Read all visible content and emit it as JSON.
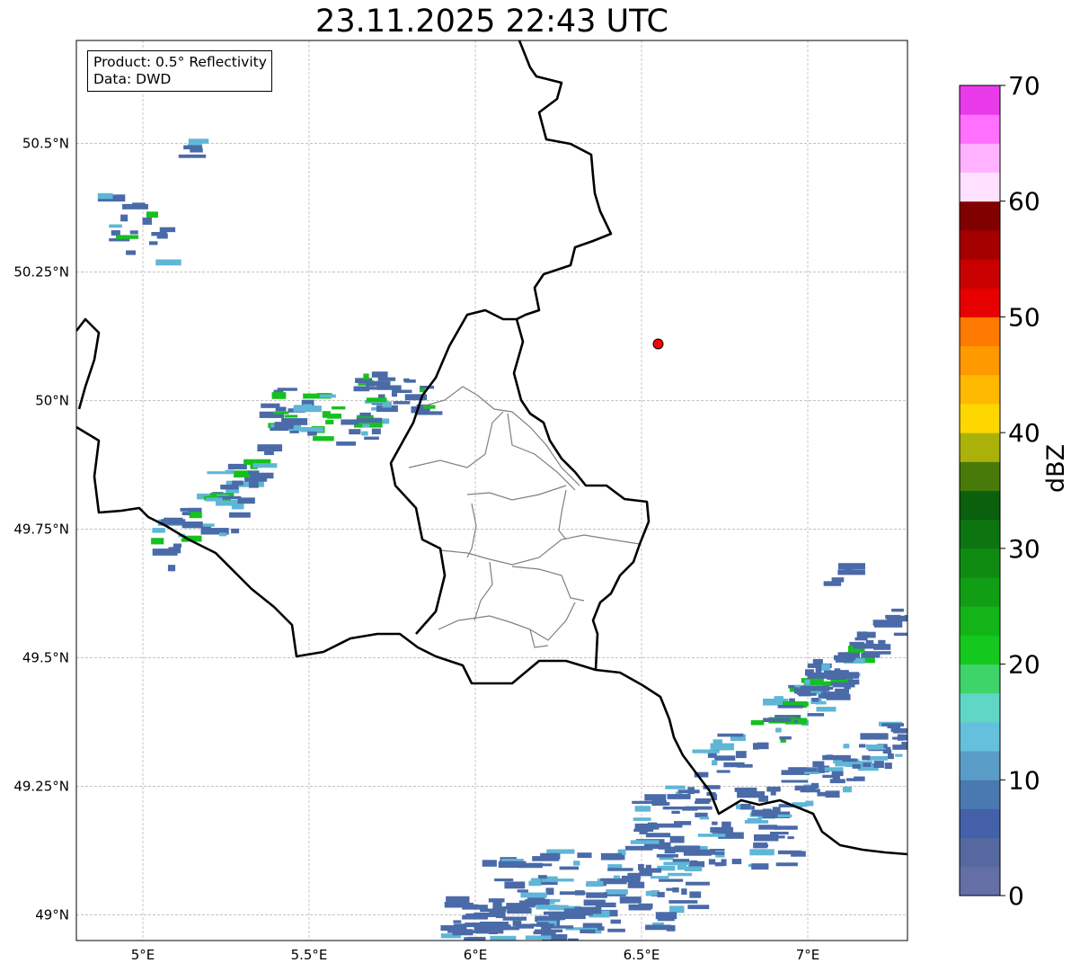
{
  "title": "23.11.2025 22:43 UTC",
  "legend": {
    "product": "Product: 0.5° Reflectivity",
    "data": "Data: DWD"
  },
  "axes": {
    "lon_range": [
      4.8,
      7.3
    ],
    "lat_range": [
      48.95,
      50.7
    ],
    "x_ticks": [
      {
        "value": 5.0,
        "label": "5°E"
      },
      {
        "value": 5.5,
        "label": "5.5°E"
      },
      {
        "value": 6.0,
        "label": "6°E"
      },
      {
        "value": 6.5,
        "label": "6.5°E"
      },
      {
        "value": 7.0,
        "label": "7°E"
      }
    ],
    "y_ticks": [
      {
        "value": 49.0,
        "label": "49°N"
      },
      {
        "value": 49.25,
        "label": "49.25°N"
      },
      {
        "value": 49.5,
        "label": "49.5°N"
      },
      {
        "value": 49.75,
        "label": "49.75°N"
      },
      {
        "value": 50.0,
        "label": "50°N"
      },
      {
        "value": 50.25,
        "label": "50.25°N"
      },
      {
        "value": 50.5,
        "label": "50.5°N"
      }
    ],
    "grid": true
  },
  "radar_site": {
    "lon": 6.55,
    "lat": 50.11,
    "color": "#ff0000"
  },
  "colorbar": {
    "label": "dBZ",
    "vmin": 0,
    "vmax": 70,
    "ticks": [
      "0",
      "10",
      "20",
      "30",
      "40",
      "50",
      "60",
      "70"
    ],
    "tick_values": [
      0,
      10,
      20,
      30,
      40,
      50,
      60,
      70
    ],
    "colors": [
      "#646fa6",
      "#5569a0",
      "#4460a8",
      "#4a78b0",
      "#5a9cc8",
      "#64c0dc",
      "#5fd6c6",
      "#3ed46a",
      "#14c81e",
      "#13b417",
      "#119e14",
      "#0f8a11",
      "#0c7510",
      "#0a600c",
      "#487a0a",
      "#aab20a",
      "#ffd700",
      "#ffb900",
      "#ff9900",
      "#ff7a00",
      "#e60000",
      "#c80000",
      "#a50000",
      "#800000",
      "#ffe0ff",
      "#ffb2ff",
      "#ff70ff",
      "#e83ae8"
    ]
  },
  "colors": {
    "echo_light": "#4a6aa8",
    "echo_medium": "#5fb6d6",
    "echo_strong": "#16c01e",
    "border": "#000000",
    "internal_boundary": "#808080",
    "grid": "#b0b0b0"
  }
}
